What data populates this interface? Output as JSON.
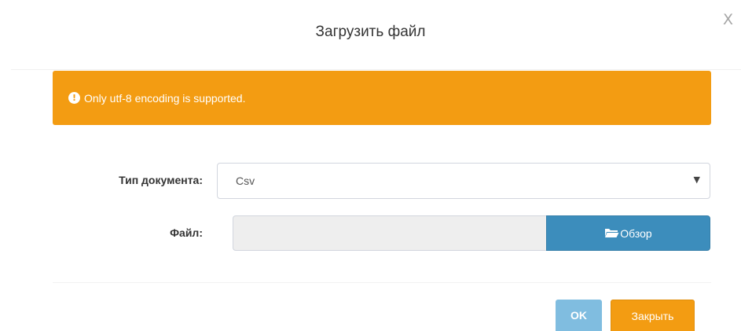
{
  "modal": {
    "title": "Загрузить файл",
    "close_label": "X"
  },
  "alert": {
    "icon": "exclamation-circle-icon",
    "icon_glyph": "!",
    "message": "Only utf-8 encoding is supported.",
    "color": "#f39c12"
  },
  "form": {
    "doc_type_label": "Тип документа:",
    "doc_type_value": "Csv",
    "file_label": "Файл:",
    "browse_label": "Обзор",
    "browse_icon": "folder-open-icon"
  },
  "footer": {
    "ok_label": "OK",
    "close_label": "Закрыть"
  },
  "colors": {
    "primary": "#3c8dbc",
    "primary_disabled": "#80bde0",
    "warning": "#f39c12"
  }
}
